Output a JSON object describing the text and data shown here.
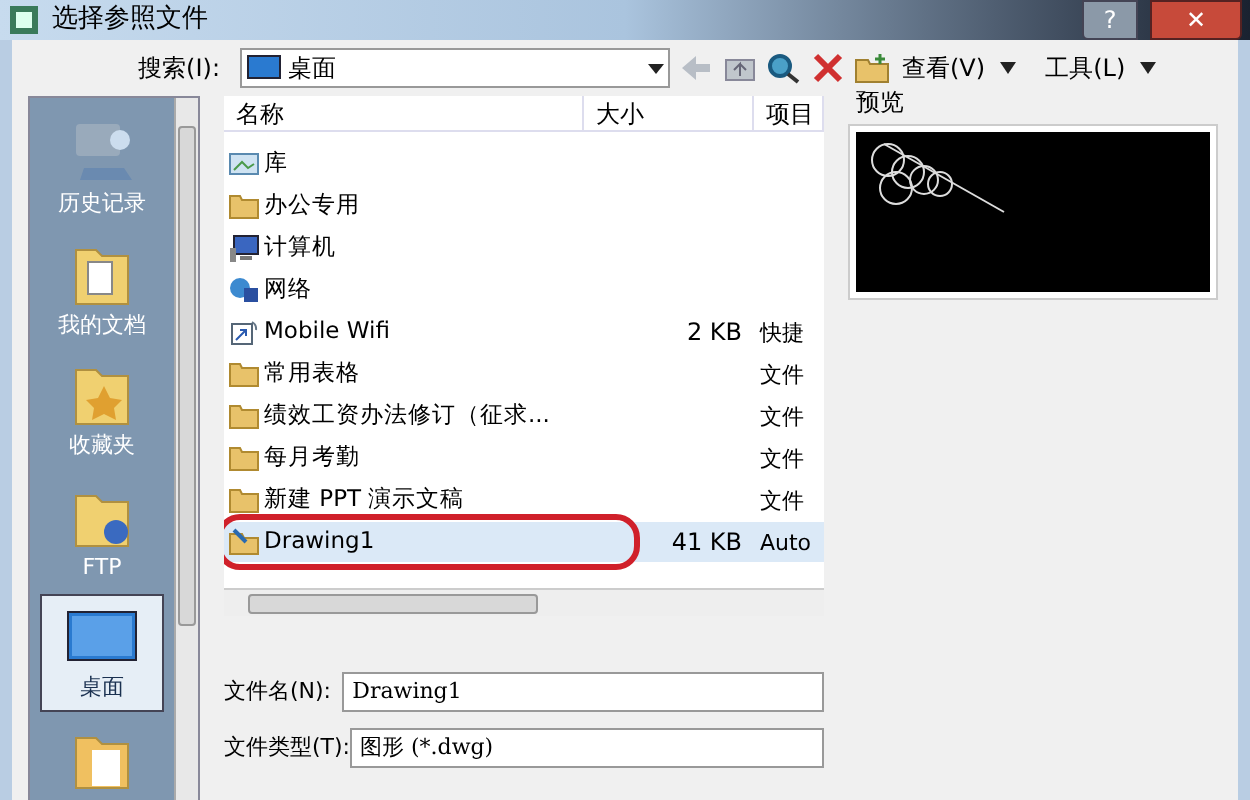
{
  "window": {
    "title": "选择参照文件",
    "buttons": [
      "?",
      "✕"
    ]
  },
  "toolbar": {
    "search_label": "搜索(I):",
    "location": "桌面",
    "view_menu": "查看(V)",
    "tools_menu": "工具(L)"
  },
  "sidebar": {
    "items": [
      {
        "label": "历史记录",
        "kind": "history",
        "selected": false
      },
      {
        "label": "我的文档",
        "kind": "documents",
        "selected": false
      },
      {
        "label": "收藏夹",
        "kind": "favorites",
        "selected": false
      },
      {
        "label": "FTP",
        "kind": "ftp",
        "selected": false
      },
      {
        "label": "桌面",
        "kind": "desktop",
        "selected": true
      },
      {
        "kind": "folder",
        "selected": false
      }
    ]
  },
  "table": {
    "columns": [
      "名称",
      "大小",
      "项目"
    ],
    "rows": [
      {
        "name": "库",
        "kind": "library",
        "selected": false
      },
      {
        "name": "办公专用",
        "kind": "folder",
        "selected": false
      },
      {
        "name": "计算机",
        "kind": "computer",
        "selected": false
      },
      {
        "name": "网络",
        "kind": "network",
        "selected": false
      },
      {
        "name": "Mobile Wifi",
        "kind": "shortcut",
        "size": "2 KB",
        "type": "快捷",
        "selected": false
      },
      {
        "name": "常用表格",
        "kind": "folder",
        "type": "文件",
        "selected": false
      },
      {
        "name": "绩效工资办法修订（征求...",
        "kind": "folder",
        "type": "文件",
        "selected": false
      },
      {
        "name": "每月考勤",
        "kind": "folder",
        "type": "文件",
        "selected": false
      },
      {
        "name": "新建 PPT 演示文稿",
        "kind": "folder",
        "type": "文件",
        "selected": false
      },
      {
        "name": "Drawing1",
        "kind": "drawing",
        "size": "41 KB",
        "type": "Auto",
        "selected": true
      }
    ]
  },
  "preview": {
    "label": "预览"
  },
  "filename": {
    "label": "文件名(N):",
    "value": "Drawing1"
  },
  "filetype": {
    "label": "文件类型(T):",
    "value": "图形 (*.dwg)"
  }
}
